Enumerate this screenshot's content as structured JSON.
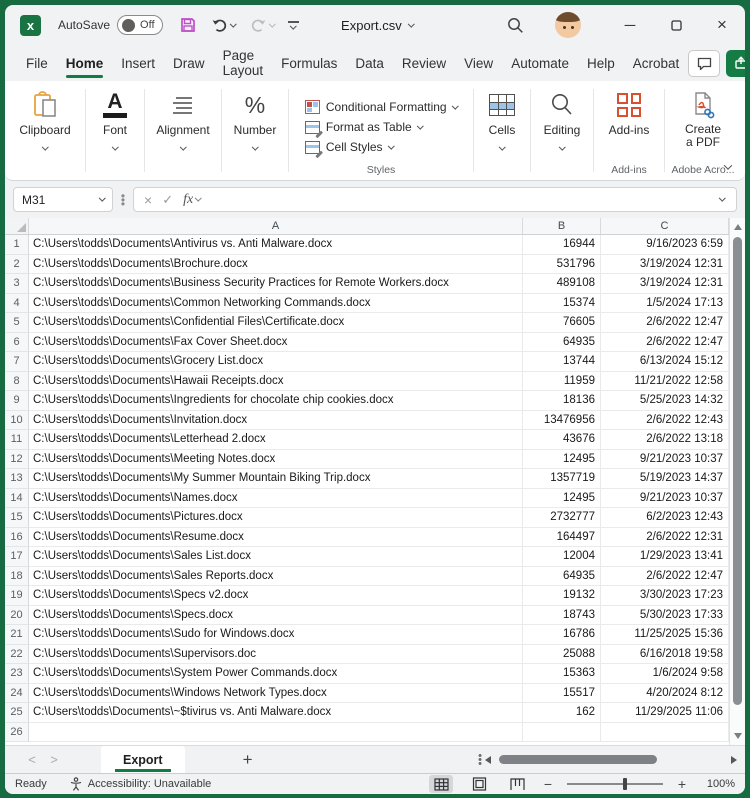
{
  "window": {
    "app_initial": "x",
    "autosave_label": "AutoSave",
    "autosave_state": "Off",
    "title": "Export.csv",
    "accent_green": "#107c41",
    "save_icon_color": "#bf4fc9"
  },
  "menu": {
    "tabs": [
      "File",
      "Home",
      "Insert",
      "Draw",
      "Page Layout",
      "Formulas",
      "Data",
      "Review",
      "View",
      "Automate",
      "Help",
      "Acrobat"
    ],
    "active_tab": "Home"
  },
  "ribbon": {
    "clipboard_label": "Clipboard",
    "font_label": "Font",
    "alignment_label": "Alignment",
    "number_label": "Number",
    "conditional_formatting_label": "Conditional Formatting",
    "format_as_table_label": "Format as Table",
    "cell_styles_label": "Cell Styles",
    "styles_group_label": "Styles",
    "cells_label": "Cells",
    "editing_label": "Editing",
    "addins_label": "Add-ins",
    "addins_group_label": "Add-ins",
    "create_pdf_line1": "Create",
    "create_pdf_line2": "a PDF",
    "adobe_group_label": "Adobe Acro..."
  },
  "formula_bar": {
    "name_box_value": "M31",
    "fx_label": "fx",
    "formula_value": ""
  },
  "grid": {
    "column_headers": [
      "A",
      "B",
      "C"
    ],
    "rows": [
      {
        "n": 1,
        "path": "C:\\Users\\todds\\Documents\\Antivirus vs. Anti Malware.docx",
        "size": "16944",
        "date": "9/16/2023 6:59"
      },
      {
        "n": 2,
        "path": "C:\\Users\\todds\\Documents\\Brochure.docx",
        "size": "531796",
        "date": "3/19/2024 12:31"
      },
      {
        "n": 3,
        "path": "C:\\Users\\todds\\Documents\\Business Security Practices for Remote Workers.docx",
        "size": "489108",
        "date": "3/19/2024 12:31"
      },
      {
        "n": 4,
        "path": "C:\\Users\\todds\\Documents\\Common Networking Commands.docx",
        "size": "15374",
        "date": "1/5/2024 17:13"
      },
      {
        "n": 5,
        "path": "C:\\Users\\todds\\Documents\\Confidential Files\\Certificate.docx",
        "size": "76605",
        "date": "2/6/2022 12:47"
      },
      {
        "n": 6,
        "path": "C:\\Users\\todds\\Documents\\Fax Cover Sheet.docx",
        "size": "64935",
        "date": "2/6/2022 12:47"
      },
      {
        "n": 7,
        "path": "C:\\Users\\todds\\Documents\\Grocery List.docx",
        "size": "13744",
        "date": "6/13/2024 15:12"
      },
      {
        "n": 8,
        "path": "C:\\Users\\todds\\Documents\\Hawaii Receipts.docx",
        "size": "11959",
        "date": "11/21/2022 12:58"
      },
      {
        "n": 9,
        "path": "C:\\Users\\todds\\Documents\\Ingredients for chocolate chip cookies.docx",
        "size": "18136",
        "date": "5/25/2023 14:32"
      },
      {
        "n": 10,
        "path": "C:\\Users\\todds\\Documents\\Invitation.docx",
        "size": "13476956",
        "date": "2/6/2022 12:43"
      },
      {
        "n": 11,
        "path": "C:\\Users\\todds\\Documents\\Letterhead 2.docx",
        "size": "43676",
        "date": "2/6/2022 13:18"
      },
      {
        "n": 12,
        "path": "C:\\Users\\todds\\Documents\\Meeting Notes.docx",
        "size": "12495",
        "date": "9/21/2023 10:37"
      },
      {
        "n": 13,
        "path": "C:\\Users\\todds\\Documents\\My Summer Mountain Biking Trip.docx",
        "size": "1357719",
        "date": "5/19/2023 14:37"
      },
      {
        "n": 14,
        "path": "C:\\Users\\todds\\Documents\\Names.docx",
        "size": "12495",
        "date": "9/21/2023 10:37"
      },
      {
        "n": 15,
        "path": "C:\\Users\\todds\\Documents\\Pictures.docx",
        "size": "2732777",
        "date": "6/2/2023 12:43"
      },
      {
        "n": 16,
        "path": "C:\\Users\\todds\\Documents\\Resume.docx",
        "size": "164497",
        "date": "2/6/2022 12:31"
      },
      {
        "n": 17,
        "path": "C:\\Users\\todds\\Documents\\Sales List.docx",
        "size": "12004",
        "date": "1/29/2023 13:41"
      },
      {
        "n": 18,
        "path": "C:\\Users\\todds\\Documents\\Sales Reports.docx",
        "size": "64935",
        "date": "2/6/2022 12:47"
      },
      {
        "n": 19,
        "path": "C:\\Users\\todds\\Documents\\Specs v2.docx",
        "size": "19132",
        "date": "3/30/2023 17:23"
      },
      {
        "n": 20,
        "path": "C:\\Users\\todds\\Documents\\Specs.docx",
        "size": "18743",
        "date": "5/30/2023 17:33"
      },
      {
        "n": 21,
        "path": "C:\\Users\\todds\\Documents\\Sudo for Windows.docx",
        "size": "16786",
        "date": "11/25/2025 15:36"
      },
      {
        "n": 22,
        "path": "C:\\Users\\todds\\Documents\\Supervisors.doc",
        "size": "25088",
        "date": "6/16/2018 19:58"
      },
      {
        "n": 23,
        "path": "C:\\Users\\todds\\Documents\\System Power Commands.docx",
        "size": "15363",
        "date": "1/6/2024 9:58"
      },
      {
        "n": 24,
        "path": "C:\\Users\\todds\\Documents\\Windows Network Types.docx",
        "size": "15517",
        "date": "4/20/2024 8:12"
      },
      {
        "n": 25,
        "path": "C:\\Users\\todds\\Documents\\~$tivirus vs. Anti Malware.docx",
        "size": "162",
        "date": "11/29/2025 11:06"
      }
    ],
    "trailing_row_number": 26
  },
  "sheet_bar": {
    "active_tab": "Export"
  },
  "status_bar": {
    "mode": "Ready",
    "accessibility": "Accessibility: Unavailable",
    "zoom_level": "100%"
  }
}
